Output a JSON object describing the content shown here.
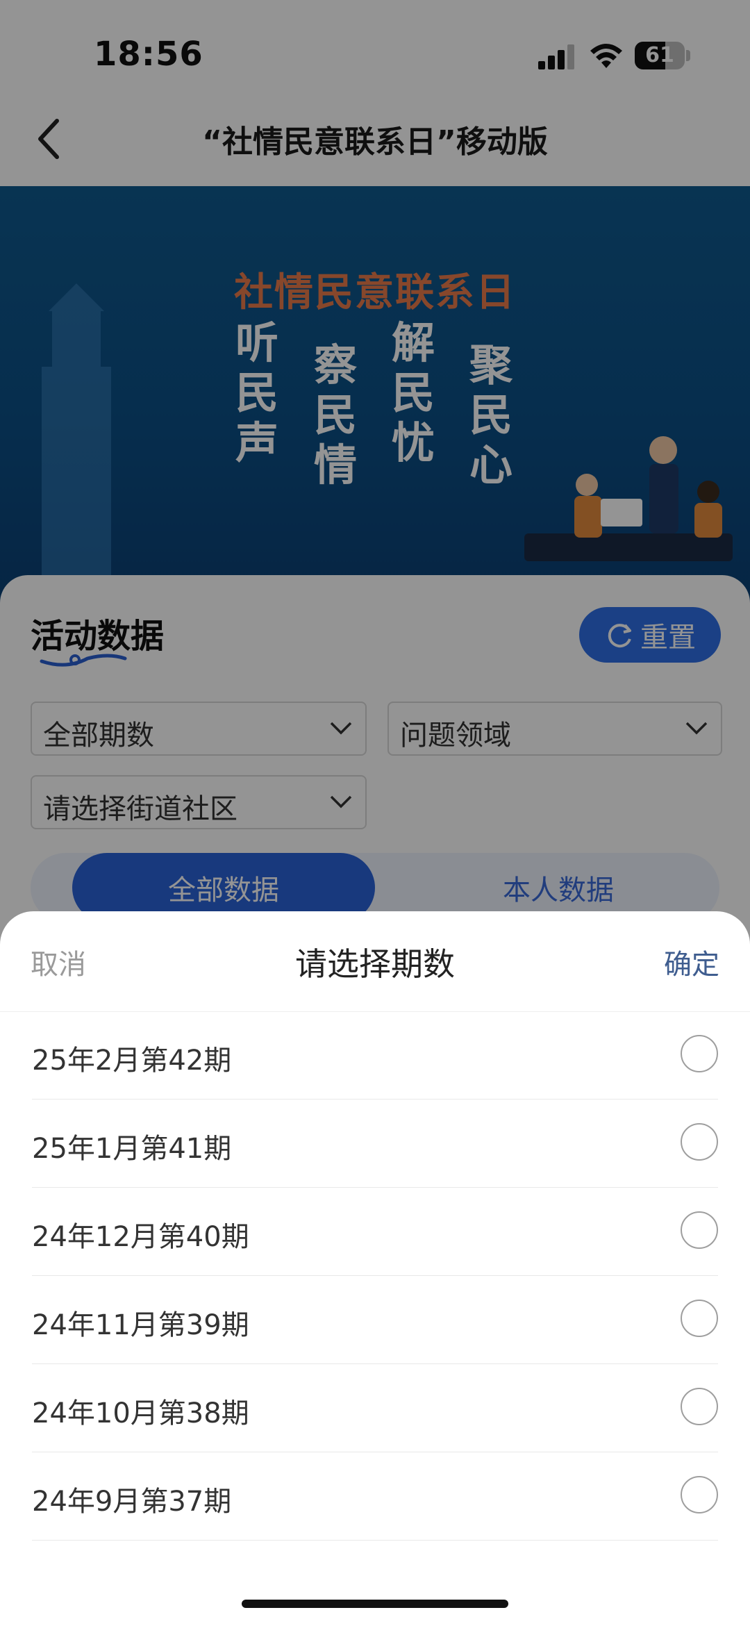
{
  "status_bar": {
    "time": "18:56",
    "battery": "61",
    "battery_level": 0.61
  },
  "nav": {
    "title": "“社情民意联系日”移动版",
    "back_icon": "chevron-left-icon"
  },
  "banner": {
    "title": "社情民意联系日",
    "slogans": [
      "听民声",
      "察民情",
      "解民忧",
      "聚民心"
    ]
  },
  "page": {
    "title": "活动数据",
    "reset_label": "重置",
    "filters": {
      "period": "全部期数",
      "field": "问题领域",
      "street": "请选择街道社区"
    },
    "tabs": [
      "全部数据",
      "本人数据"
    ]
  },
  "sheet": {
    "cancel": "取消",
    "title": "请选择期数",
    "confirm": "确定",
    "options": [
      "25年2月第42期",
      "25年1月第41期",
      "24年12月第40期",
      "24年11月第39期",
      "24年10月第38期",
      "24年9月第37期"
    ]
  },
  "colors": {
    "accent": "#2f6fe6",
    "banner": "#0f5a8e",
    "confirm": "#3f5d8f",
    "banner_title": "#e87a4b"
  }
}
